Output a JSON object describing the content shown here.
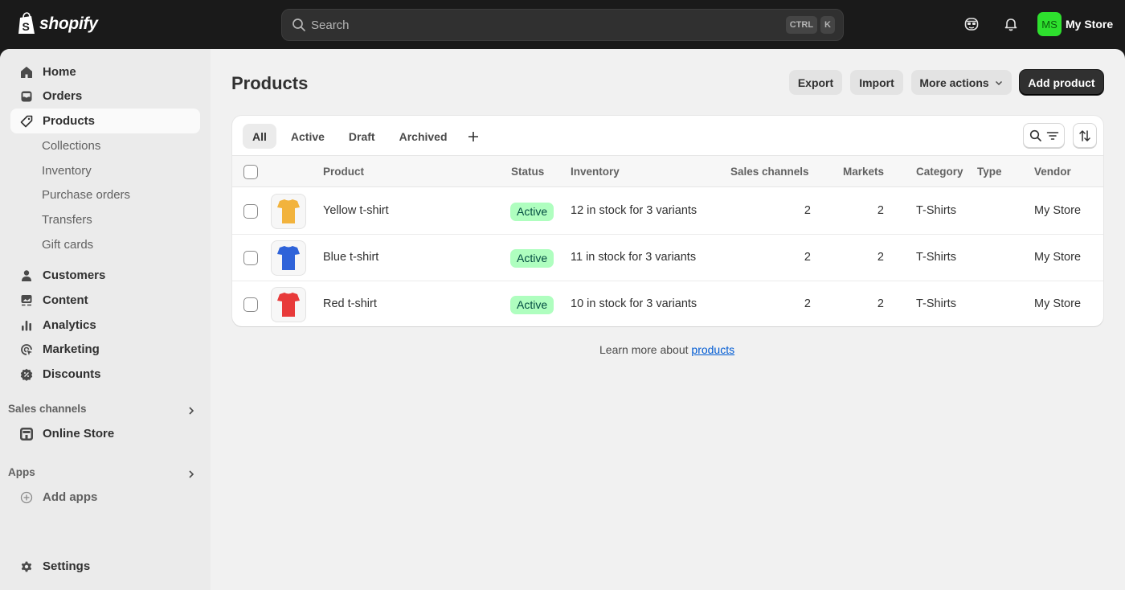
{
  "topbar": {
    "brand": "shopify",
    "search": {
      "placeholder": "Search",
      "shortcut": [
        "CTRL",
        "K"
      ]
    },
    "icons": [
      "sidekick-icon",
      "bell-icon"
    ],
    "account": {
      "initials": "MS",
      "name": "My Store",
      "avatar_color": "#2ee02e"
    }
  },
  "sidebar": {
    "items": [
      {
        "label": "Home",
        "icon": "home-icon"
      },
      {
        "label": "Orders",
        "icon": "inbox-icon"
      },
      {
        "label": "Products",
        "icon": "tag-icon",
        "active": true
      },
      {
        "label": "Customers",
        "icon": "person-icon"
      },
      {
        "label": "Content",
        "icon": "content-icon"
      },
      {
        "label": "Analytics",
        "icon": "bar-chart-icon"
      },
      {
        "label": "Marketing",
        "icon": "target-icon"
      },
      {
        "label": "Discounts",
        "icon": "discount-icon"
      }
    ],
    "product_subitems": [
      "Collections",
      "Inventory",
      "Purchase orders",
      "Transfers",
      "Gift cards"
    ],
    "sales_channels": {
      "label": "Sales channels",
      "items": [
        {
          "label": "Online Store",
          "icon": "store-icon"
        }
      ]
    },
    "apps": {
      "label": "Apps",
      "items": [
        {
          "label": "Add apps",
          "icon": "plus-circle-icon"
        }
      ]
    },
    "settings": {
      "label": "Settings",
      "icon": "gear-icon"
    }
  },
  "page": {
    "title": "Products",
    "actions": {
      "export": "Export",
      "import": "Import",
      "more": "More actions",
      "primary": "Add product"
    }
  },
  "tabs": [
    {
      "label": "All",
      "active": true
    },
    {
      "label": "Active"
    },
    {
      "label": "Draft"
    },
    {
      "label": "Archived"
    }
  ],
  "table": {
    "columns": [
      "Product",
      "Status",
      "Inventory",
      "Sales channels",
      "Markets",
      "Category",
      "Type",
      "Vendor"
    ],
    "rows": [
      {
        "product": "Yellow t-shirt",
        "color": "#f2b33d",
        "status": "Active",
        "inventory": "12 in stock for 3 variants",
        "sales_channels": "2",
        "markets": "2",
        "category": "T-Shirts",
        "type": "",
        "vendor": "My Store"
      },
      {
        "product": "Blue t-shirt",
        "color": "#2f63d9",
        "status": "Active",
        "inventory": "11 in stock for 3 variants",
        "sales_channels": "2",
        "markets": "2",
        "category": "T-Shirts",
        "type": "",
        "vendor": "My Store"
      },
      {
        "product": "Red t-shirt",
        "color": "#e83a3a",
        "status": "Active",
        "inventory": "10 in stock for 3 variants",
        "sales_channels": "2",
        "markets": "2",
        "category": "T-Shirts",
        "type": "",
        "vendor": "My Store"
      }
    ]
  },
  "footer": {
    "prefix": "Learn more about ",
    "link": "products"
  },
  "colors": {
    "status_active_bg": "#affebf",
    "status_active_text": "#014b40",
    "link": "#005bd3",
    "primary_button": "#303030"
  }
}
